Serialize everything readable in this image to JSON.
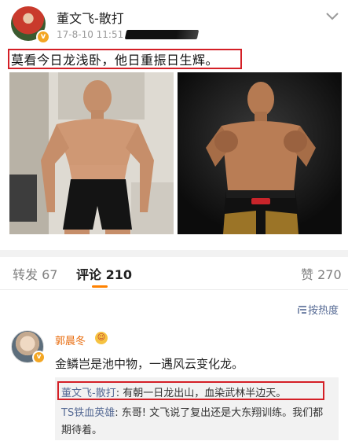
{
  "post": {
    "author": "董文飞-散打",
    "time": "17-8-10 11:51",
    "text": "莫看今日龙浅卧，他日重振日生辉。"
  },
  "tabs": {
    "repost": "转发 67",
    "comments": "评论 210",
    "likes": "赞 270"
  },
  "sort": {
    "label": "按热度",
    "icon": "sort-icon"
  },
  "comment": {
    "author": "郭晨冬",
    "text": "金鳞岂是池中物，一遇风云变化龙。",
    "replies": [
      {
        "author": "董文飞-散打",
        "sep": ": ",
        "text": "有朝一日龙出山，血染武林半边天。"
      },
      {
        "author": "TS铁血英雄",
        "sep": ": ",
        "text": "东哥! 文飞说了复出还是大东翔训练。我们都期待着。"
      }
    ]
  },
  "colors": {
    "highlight_border": "#d41f26",
    "accent_orange": "#ff8200",
    "link_blue": "#576b95",
    "name_orange": "#e86b0c"
  }
}
